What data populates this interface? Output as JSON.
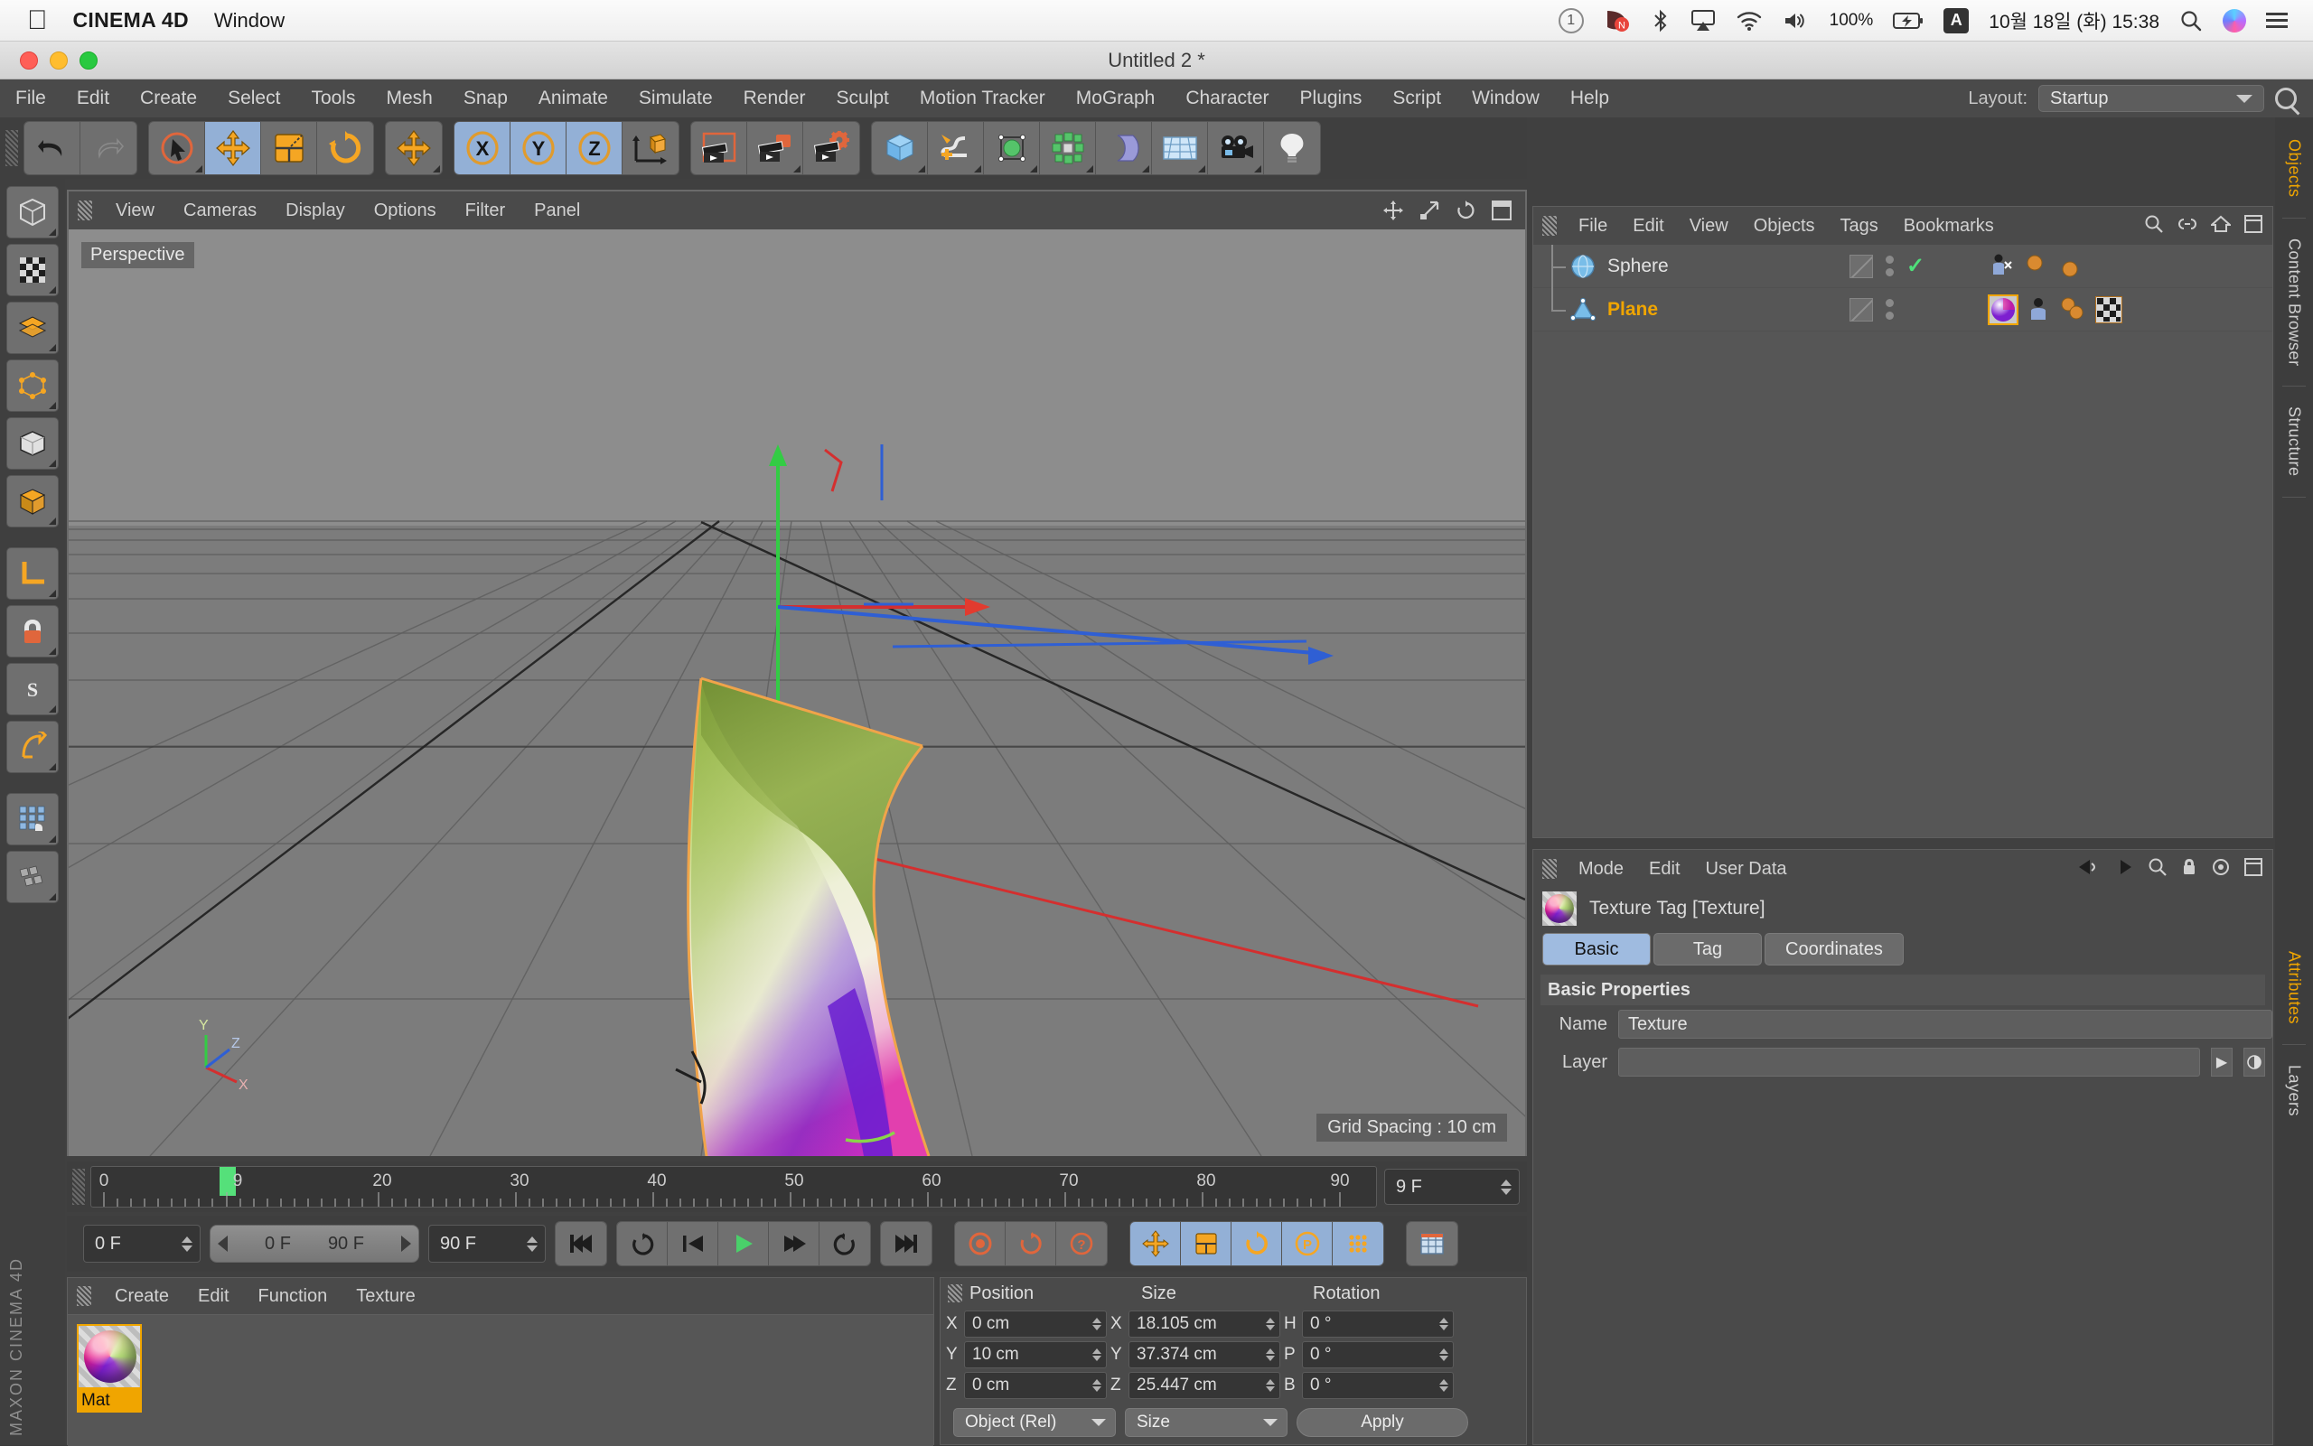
{
  "macos": {
    "apple_icon": "apple-logo",
    "app_name": "CINEMA 4D",
    "menus": [
      "Window"
    ],
    "status": {
      "user_badge": "1",
      "notification_icon": "notification-icon",
      "bluetooth_icon": "bluetooth-icon",
      "airplay_icon": "airplay-icon",
      "wifi_icon": "wifi-icon",
      "volume_icon": "volume-icon",
      "battery_pct": "100%",
      "battery_icon": "battery-charging-icon",
      "input_source": "A",
      "datetime": "10월 18일 (화)  15:38",
      "search_icon": "spotlight-search-icon",
      "siri_icon": "siri-icon",
      "control_center_icon": "control-center-icon"
    }
  },
  "window": {
    "title": "Untitled 2 *"
  },
  "menubar": {
    "items": [
      "File",
      "Edit",
      "Create",
      "Select",
      "Tools",
      "Mesh",
      "Snap",
      "Animate",
      "Simulate",
      "Render",
      "Sculpt",
      "Motion Tracker",
      "MoGraph",
      "Character",
      "Plugins",
      "Script",
      "Window",
      "Help"
    ],
    "layout_label": "Layout:",
    "layout_value": "Startup",
    "search_icon": "search-icon"
  },
  "toolbar": {
    "groups": [
      {
        "buttons": [
          {
            "name": "undo-button",
            "icon": "undo-arrow-icon",
            "active": false
          },
          {
            "name": "redo-button",
            "icon": "redo-arrow-icon",
            "active": false
          }
        ]
      },
      {
        "buttons": [
          {
            "name": "live-select-tool",
            "icon": "cursor-circle-icon",
            "active": false
          },
          {
            "name": "move-tool",
            "icon": "move-arrows-icon",
            "active": true
          },
          {
            "name": "scale-tool",
            "icon": "scale-square-icon",
            "active": false
          },
          {
            "name": "rotate-tool",
            "icon": "rotate-circle-icon",
            "active": false
          }
        ]
      },
      {
        "buttons": [
          {
            "name": "move-axis-tool",
            "icon": "move-arrows-icon",
            "active": false
          }
        ]
      },
      {
        "buttons": [
          {
            "name": "axis-x-lock",
            "icon": "x-axis-icon",
            "active": true
          },
          {
            "name": "axis-y-lock",
            "icon": "y-axis-icon",
            "active": true
          },
          {
            "name": "axis-z-lock",
            "icon": "z-axis-icon",
            "active": true
          },
          {
            "name": "coordinate-system-toggle",
            "icon": "world-object-axis-icon",
            "active": false
          }
        ]
      },
      {
        "buttons": [
          {
            "name": "render-view-button",
            "icon": "render-view-icon",
            "active": false
          },
          {
            "name": "render-region-button",
            "icon": "render-to-picture-viewer-icon",
            "active": false
          },
          {
            "name": "render-settings-button",
            "icon": "render-settings-icon",
            "active": false
          }
        ]
      },
      {
        "buttons": [
          {
            "name": "add-cube-button",
            "icon": "cube-icon",
            "active": false
          },
          {
            "name": "add-spline-button",
            "icon": "spline-pen-icon",
            "active": false
          },
          {
            "name": "add-subdivision-surface-button",
            "icon": "subdivision-surface-icon",
            "active": false
          },
          {
            "name": "add-mograph-button",
            "icon": "mograph-cloner-icon",
            "active": false
          },
          {
            "name": "add-deformer-button",
            "icon": "bend-deformer-icon",
            "active": false
          },
          {
            "name": "add-environment-button",
            "icon": "floor-grid-icon",
            "active": false
          },
          {
            "name": "add-camera-button",
            "icon": "camera-icon",
            "active": false
          },
          {
            "name": "add-light-button",
            "icon": "light-bulb-icon",
            "active": false
          }
        ]
      }
    ]
  },
  "left_rail": {
    "buttons": [
      {
        "name": "model-mode-button",
        "icon": "model-mode-icon"
      },
      {
        "name": "texture-mode-button",
        "icon": "texture-axis-icon"
      },
      {
        "name": "polygon-mode-button",
        "icon": "polygon-mode-icon"
      },
      {
        "name": "point-mode-button",
        "icon": "point-mode-icon"
      },
      {
        "name": "edge-mode-button",
        "icon": "edge-mode-icon"
      },
      {
        "name": "object-mode-button",
        "icon": "object-mode-icon"
      },
      {
        "name": "workplane-button",
        "icon": "workplane-icon"
      },
      {
        "name": "lock-workplane-button",
        "icon": "lock-icon"
      },
      {
        "name": "snap-toggle-button",
        "icon": "snap-magnet-icon"
      },
      {
        "name": "quantize-button",
        "icon": "quantize-icon"
      },
      {
        "name": "enable-axis-button",
        "icon": "axis-modify-icon"
      },
      {
        "name": "viewport-solo-button",
        "icon": "solo-icon"
      }
    ],
    "brand": "MAXON CINEMA 4D"
  },
  "viewport": {
    "menus": [
      "View",
      "Cameras",
      "Display",
      "Options",
      "Filter",
      "Panel"
    ],
    "view_label": "Perspective",
    "grid_spacing": "Grid Spacing : 10 cm",
    "axis_labels": {
      "x": "X",
      "y": "Y",
      "z": "Z"
    },
    "header_icons": [
      "move-view-icon",
      "scale-view-icon",
      "rotate-view-icon",
      "maximize-view-icon"
    ]
  },
  "timeline": {
    "ticks": [
      "0",
      "9",
      "20",
      "30",
      "40",
      "50",
      "60",
      "70",
      "80",
      "90"
    ],
    "tick_values": [
      0,
      9,
      20,
      30,
      40,
      50,
      60,
      70,
      80,
      90
    ],
    "range_start": 0,
    "range_end": 90,
    "playhead_frame": 9,
    "current_frame_field": "9 F"
  },
  "playback": {
    "start_frame": "0 F",
    "preview_min": "0 F",
    "preview_max": "90 F",
    "end_frame": "90 F",
    "buttons": [
      {
        "name": "go-to-start-button",
        "icon": "skip-to-start-icon",
        "active": false
      },
      {
        "name": "step-back-keyframe-button",
        "icon": "prev-keyframe-icon",
        "active": false
      },
      {
        "name": "step-back-frame-button",
        "icon": "step-back-icon",
        "active": false
      },
      {
        "name": "play-button",
        "icon": "play-icon",
        "active": false
      },
      {
        "name": "step-forward-frame-button",
        "icon": "step-forward-icon",
        "active": false
      },
      {
        "name": "next-keyframe-button",
        "icon": "next-keyframe-icon",
        "active": false
      },
      {
        "name": "go-to-end-button",
        "icon": "skip-to-end-icon",
        "active": false
      }
    ],
    "record_buttons": [
      {
        "name": "record-keyframe-button",
        "icon": "record-icon"
      },
      {
        "name": "autokey-button",
        "icon": "autokey-icon"
      },
      {
        "name": "keyframe-selection-button",
        "icon": "question-icon"
      }
    ],
    "param_buttons": [
      {
        "name": "position-key-toggle",
        "icon": "move-arrows-icon",
        "active": true
      },
      {
        "name": "scale-key-toggle",
        "icon": "scale-square-icon",
        "active": true
      },
      {
        "name": "rotation-key-toggle",
        "icon": "rotate-circle-icon",
        "active": true
      },
      {
        "name": "parameter-key-toggle",
        "icon": "p-letter-icon",
        "active": true
      },
      {
        "name": "point-level-animation-toggle",
        "icon": "pla-dots-icon",
        "active": true
      }
    ],
    "timeline_toggle": {
      "name": "timeline-button",
      "icon": "timeline-icon"
    }
  },
  "material_manager": {
    "menus": [
      "Create",
      "Edit",
      "Function",
      "Texture"
    ],
    "materials": [
      {
        "name": "Mat",
        "selected": true,
        "icon": "material-sphere-icon"
      }
    ]
  },
  "coordinates": {
    "columns": [
      "Position",
      "Size",
      "Rotation"
    ],
    "rows": [
      {
        "pos_axis": "X",
        "pos_value": "0 cm",
        "size_axis": "X",
        "size_value": "18.105 cm",
        "rot_axis": "H",
        "rot_value": "0 °"
      },
      {
        "pos_axis": "Y",
        "pos_value": "10 cm",
        "size_axis": "Y",
        "size_value": "37.374 cm",
        "rot_axis": "P",
        "rot_value": "0 °"
      },
      {
        "pos_axis": "Z",
        "pos_value": "0 cm",
        "size_axis": "Z",
        "size_value": "25.447 cm",
        "rot_axis": "B",
        "rot_value": "0 °"
      }
    ],
    "mode_dropdown": "Object (Rel)",
    "size_dropdown": "Size",
    "apply_label": "Apply"
  },
  "object_manager": {
    "menus": [
      "File",
      "Edit",
      "View",
      "Objects",
      "Tags",
      "Bookmarks"
    ],
    "header_icons": [
      "search-icon",
      "link-icon",
      "home-icon",
      "new-window-icon"
    ],
    "objects": [
      {
        "name": "Sphere",
        "selected": false,
        "icon": "sphere-object-icon",
        "enabled_check": true,
        "tags": [
          {
            "name": "phong-tag",
            "icon": "phong-tag-icon",
            "selected": false
          },
          {
            "name": "dot-tag-a",
            "icon": "orange-dot-icon",
            "selected": false
          },
          {
            "name": "dot-tag-b",
            "icon": "orange-dot-icon",
            "selected": false
          }
        ]
      },
      {
        "name": "Plane",
        "selected": true,
        "icon": "plane-object-icon",
        "enabled_check": false,
        "tags": [
          {
            "name": "texture-tag",
            "icon": "material-sphere-icon",
            "selected": true
          },
          {
            "name": "phong-tag",
            "icon": "phong-tag-icon",
            "selected": false
          },
          {
            "name": "dot-tag-a",
            "icon": "orange-dot-icon",
            "selected": false
          },
          {
            "name": "uvw-tag",
            "icon": "checker-tag-icon",
            "selected": false
          }
        ]
      }
    ]
  },
  "attribute_manager": {
    "menus": [
      "Mode",
      "Edit",
      "User Data"
    ],
    "header_icons": [
      "back-arrow-icon",
      "forward-arrow-icon",
      "search-icon",
      "lock-icon",
      "target-icon",
      "new-window-icon"
    ],
    "title": "Texture Tag [Texture]",
    "title_icon": "material-sphere-icon",
    "tabs": [
      {
        "label": "Basic",
        "active": true
      },
      {
        "label": "Tag",
        "active": false
      },
      {
        "label": "Coordinates",
        "active": false
      }
    ],
    "section_title": "Basic Properties",
    "fields": [
      {
        "label": "Name",
        "value": "Texture"
      },
      {
        "label": "Layer",
        "value": ""
      }
    ]
  },
  "right_rail": {
    "tabs": [
      "Objects",
      "Content Browser",
      "Structure",
      "Attributes",
      "Layers"
    ]
  },
  "colors": {
    "accent_orange": "#f0a500",
    "active_blue": "#93b0d6",
    "panel_bg": "#4a4a4a",
    "field_bg": "#353535",
    "playhead_green": "#55e07a"
  }
}
